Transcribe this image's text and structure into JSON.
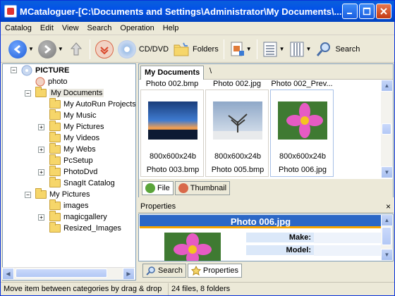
{
  "window": {
    "title": "MCataloguer-[C:\\Documents and Settings\\Administrator\\My Documents\\..."
  },
  "menu": [
    "Catalog",
    "Edit",
    "View",
    "Search",
    "Operation",
    "Help"
  ],
  "toolbar": {
    "cddvd_label": "CD/DVD",
    "folders_label": "Folders",
    "search_label": "Search"
  },
  "tree": {
    "root": "PICTURE",
    "items": [
      "photo",
      "My Documents",
      "My AutoRun Projects",
      "My Music",
      "My Pictures",
      "My Videos",
      "My Webs",
      "PcSetup",
      "PhotoDvd",
      "SnagIt Catalog",
      "My Pictures",
      "images",
      "magicgallery",
      "Resized_Images"
    ]
  },
  "content": {
    "tab_label": "My Documents",
    "path": "\\",
    "top_row": [
      "Photo 002.bmp",
      "Photo 002.jpg",
      "Photo 002_Prev..."
    ],
    "thumbs": [
      {
        "dims": "800x600x24b",
        "name": "Photo 003.bmp"
      },
      {
        "dims": "800x600x24b",
        "name": "Photo 005.bmp"
      },
      {
        "dims": "800x600x24b",
        "name": "Photo 006.jpg"
      }
    ],
    "bottom_tabs": [
      "File",
      "Thumbnail"
    ]
  },
  "properties": {
    "header": "Properties",
    "close": "×",
    "title": "Photo 006.jpg",
    "fields": [
      "Make:",
      "Model:"
    ],
    "tabs": [
      "Search",
      "Properties"
    ]
  },
  "status": {
    "hint": "Move item between categories by drag & drop",
    "count": "24 files, 8 folders"
  }
}
